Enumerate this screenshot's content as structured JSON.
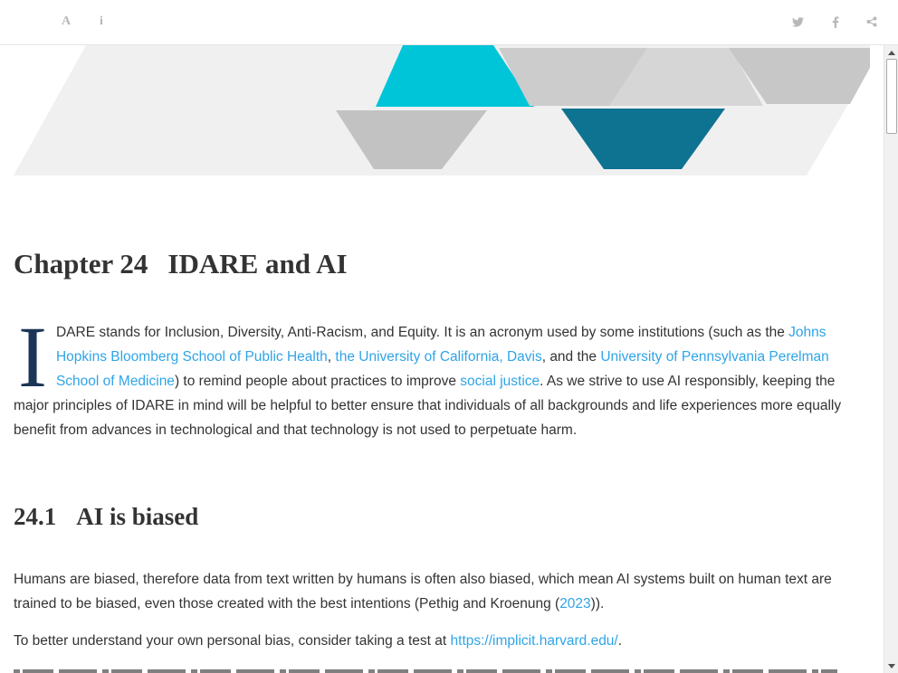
{
  "toolbar": {
    "font_settings_icon": "font-icon",
    "font_glyph": "A",
    "info_icon": "info-icon",
    "info_glyph": "i",
    "share_icons": [
      "twitter-icon",
      "facebook-icon",
      "share-icon"
    ]
  },
  "chapter": {
    "number": "Chapter 24",
    "title": "IDARE and AI"
  },
  "intro": {
    "dropcap": "I",
    "text_1": "DARE stands for Inclusion, Diversity, Anti-Racism, and Equity. It is an acronym used by some institutions (such as the ",
    "link_jhu": "Johns Hopkins Bloomberg School of Public Health",
    "sep_1": ", ",
    "link_ucd": "the University of California, Davis",
    "sep_2": ", and the ",
    "link_penn": "University of Pennsylvania Perelman School of Medicine",
    "text_2": ") to remind people about practices to improve ",
    "link_justice": "social justice",
    "text_3": ". As we strive to use AI responsibly, keeping the major principles of IDARE in mind will be helpful to better ensure that individuals of all backgrounds and life experiences more equally benefit from advances in technological and that technology is not used to perpetuate harm."
  },
  "section": {
    "number": "24.1",
    "title": "AI is biased"
  },
  "bias": {
    "text_1": "Humans are biased, therefore data from text written by humans is often also biased, which mean AI systems built on human text are trained to be biased, even those created with the best intentions (Pethig and Kroenung (",
    "cite_year": "2023",
    "text_2": ")).",
    "test_text": "To better understand your own personal bias, consider taking a test at ",
    "test_link": "https://implicit.harvard.edu/",
    "test_end": "."
  },
  "colors": {
    "link": "#2fa4e7",
    "dropcap": "#1c3557",
    "banner_cyan": "#00c4d8",
    "banner_teal": "#0e7391",
    "banner_gray": "#cccccc",
    "banner_light": "#f0f0f0"
  }
}
